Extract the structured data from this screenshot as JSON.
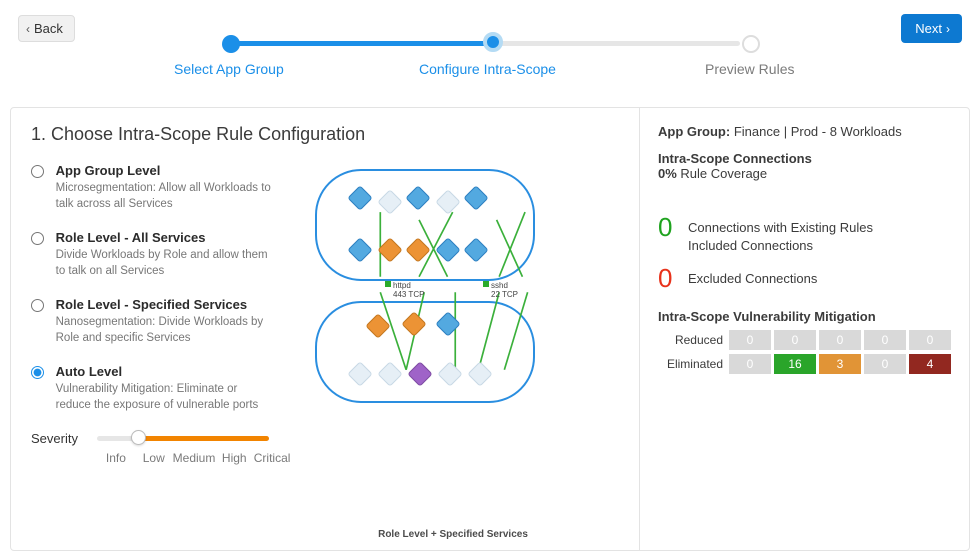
{
  "nav": {
    "back": "Back",
    "next": "Next"
  },
  "stepper": {
    "steps": [
      "Select App Group",
      "Configure Intra-Scope",
      "Preview Rules"
    ],
    "current_index": 1
  },
  "heading": "1. Choose Intra-Scope Rule Configuration",
  "options": [
    {
      "id": "app-group-level",
      "title": "App Group Level",
      "desc": "Microsegmentation: Allow all Workloads to talk across all Services",
      "selected": false
    },
    {
      "id": "role-all",
      "title": "Role Level - All Services",
      "desc": "Divide Workloads by Role and allow them to talk on all Services",
      "selected": false
    },
    {
      "id": "role-spec",
      "title": "Role Level - Specified Services",
      "desc": "Nanosegmentation: Divide Workloads by Role and specific Services",
      "selected": false
    },
    {
      "id": "auto",
      "title": "Auto Level",
      "desc": "Vulnerability Mitigation: Eliminate or reduce the exposure of vulnerable ports",
      "selected": true
    }
  ],
  "severity": {
    "label": "Severity",
    "ticks": [
      "Info",
      "Low",
      "Medium",
      "High",
      "Critical"
    ],
    "value_index": 1
  },
  "diagram": {
    "caption": "Role Level + Specified Services",
    "legend": [
      {
        "name": "httpd",
        "port": "443 TCP"
      },
      {
        "name": "sshd",
        "port": "22 TCP"
      }
    ]
  },
  "summary": {
    "app_group_label": "App Group:",
    "app_group_value": "Finance | Prod - 8 Workloads",
    "connections_title": "Intra-Scope Connections",
    "coverage_pct": "0%",
    "coverage_label": "Rule Coverage",
    "stats": [
      {
        "num": "0",
        "color": "green",
        "line1": "Connections with Existing Rules",
        "line2": "Included Connections"
      },
      {
        "num": "0",
        "color": "red",
        "line1": "Excluded Connections",
        "line2": ""
      }
    ],
    "vm_title": "Intra-Scope Vulnerability Mitigation",
    "vm_rows": [
      {
        "label": "Reduced",
        "cells": [
          {
            "v": "0",
            "c": "gray"
          },
          {
            "v": "0",
            "c": "gray"
          },
          {
            "v": "0",
            "c": "gray"
          },
          {
            "v": "0",
            "c": "gray"
          },
          {
            "v": "0",
            "c": "gray"
          }
        ]
      },
      {
        "label": "Eliminated",
        "cells": [
          {
            "v": "0",
            "c": "gray"
          },
          {
            "v": "16",
            "c": "green"
          },
          {
            "v": "3",
            "c": "orange"
          },
          {
            "v": "0",
            "c": "gray"
          },
          {
            "v": "4",
            "c": "red"
          }
        ]
      }
    ]
  }
}
